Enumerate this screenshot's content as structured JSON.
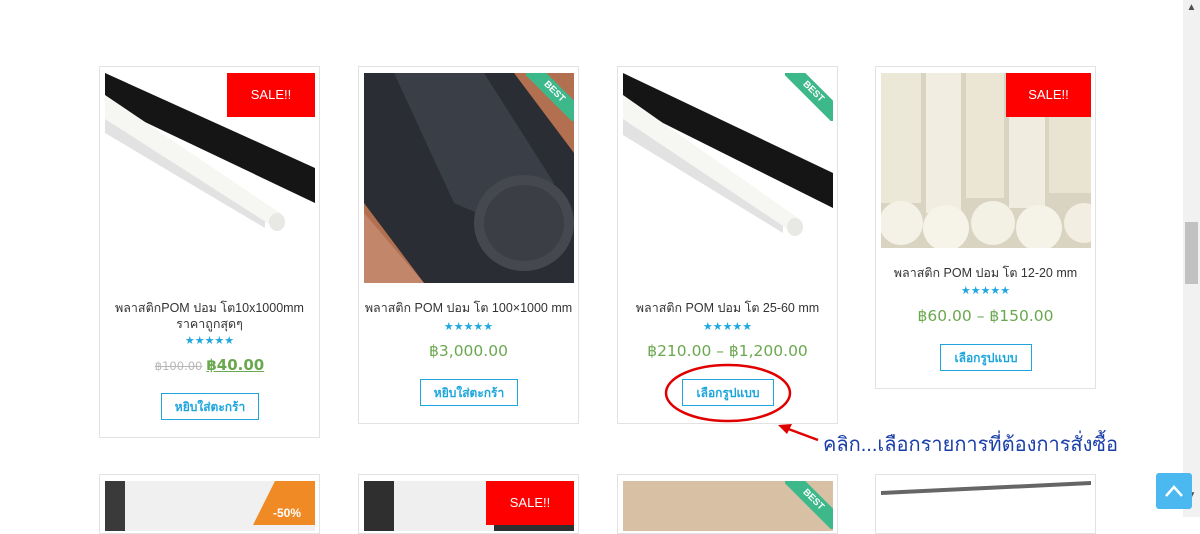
{
  "products": [
    {
      "title": "พลาสติกPOM ปอม โต10x1000mm ราคาถูกสุดๆ",
      "rating": 5,
      "old_price": "฿100.00",
      "price": "฿40.00",
      "badge": "SALE!!",
      "button": "หยิบใส่ตะกร้า"
    },
    {
      "title": "พลาสติก POM ปอม โต 100×1000 mm",
      "rating": 5,
      "price": "฿3,000.00",
      "badge": "BEST",
      "button": "หยิบใส่ตะกร้า"
    },
    {
      "title": "พลาสติก POM ปอม โต 25-60 mm",
      "rating": 5,
      "price": "฿210.00 – ฿1,200.00",
      "badge": "BEST",
      "button": "เลือกรูปแบบ"
    },
    {
      "title": "พลาสติก POM ปอม โต 12-20 mm",
      "rating": 5,
      "price": "฿60.00 – ฿150.00",
      "badge": "SALE!!",
      "button": "เลือกรูปแบบ"
    }
  ],
  "second_row_badges": {
    "card1": "-50%",
    "card2": "SALE!!",
    "card3": "BEST"
  },
  "stars_text": "★★★★★",
  "annotation": "คลิก...เลือกรายการที่ต้องการสั่งซื้อ",
  "colors": {
    "accent": "#1ea6dc",
    "price": "#6aa84f",
    "sale": "#ff0000",
    "best": "#3db88b",
    "annotation": "#1a3fa8",
    "highlight": "#e00000"
  }
}
